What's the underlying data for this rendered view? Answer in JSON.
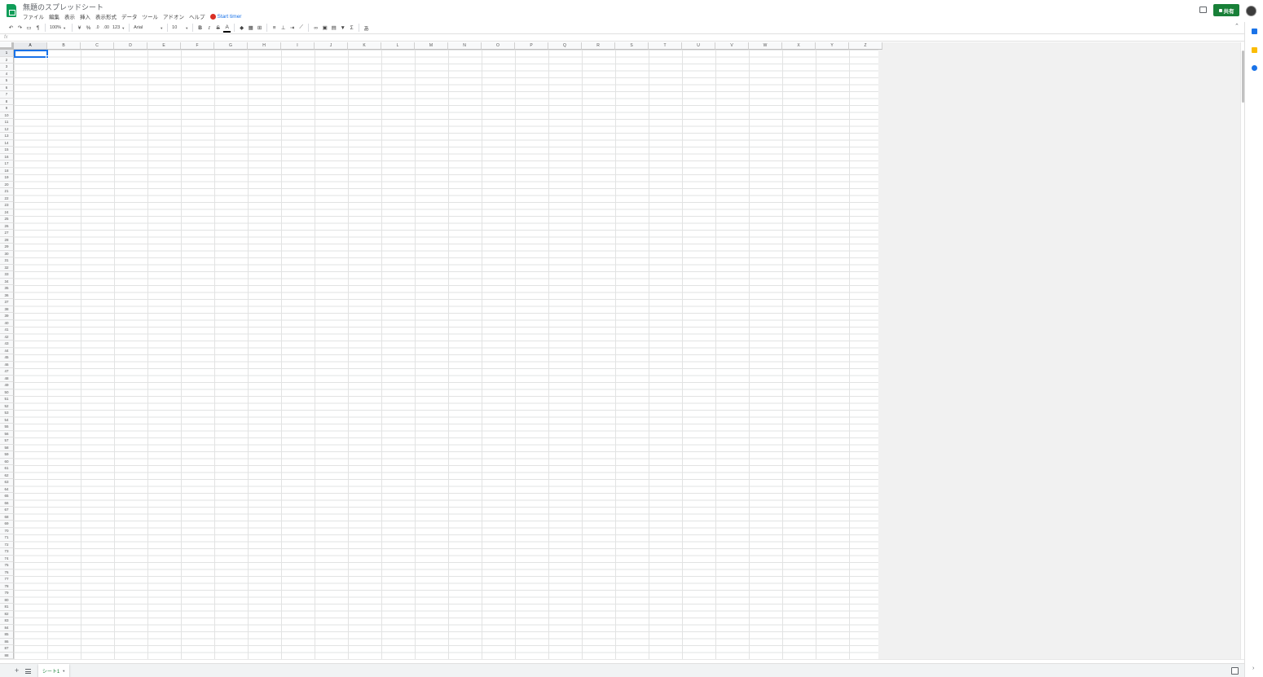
{
  "header": {
    "title": "無題のスプレッドシート",
    "menus": [
      "ファイル",
      "編集",
      "表示",
      "挿入",
      "表示形式",
      "データ",
      "ツール",
      "アドオン",
      "ヘルプ"
    ],
    "timer_label": "Start timer",
    "share_label": "共有"
  },
  "toolbar": {
    "zoom": "100%",
    "currency": "¥",
    "percent": "%",
    "decimal_decrease": ".0",
    "decimal_increase": ".00",
    "number_format": "123",
    "font": "Arial",
    "font_size": "10",
    "bold": "B",
    "italic": "I",
    "strike": "S",
    "text_color": "A",
    "sum": "Σ"
  },
  "formula_bar": {
    "fx_label": "fx"
  },
  "grid": {
    "columns": [
      "A",
      "B",
      "C",
      "D",
      "E",
      "F",
      "G",
      "H",
      "I",
      "J",
      "K",
      "L",
      "M",
      "N",
      "O",
      "P",
      "Q",
      "R",
      "S",
      "T",
      "U",
      "V",
      "W",
      "X",
      "Y",
      "Z"
    ],
    "row_count": 88,
    "selected_cell": "A1"
  },
  "sheets": {
    "active_tab": "シート1"
  },
  "colors": {
    "accent": "#1a73e8",
    "share": "#188038",
    "sheets_brand": "#0f9d58"
  }
}
